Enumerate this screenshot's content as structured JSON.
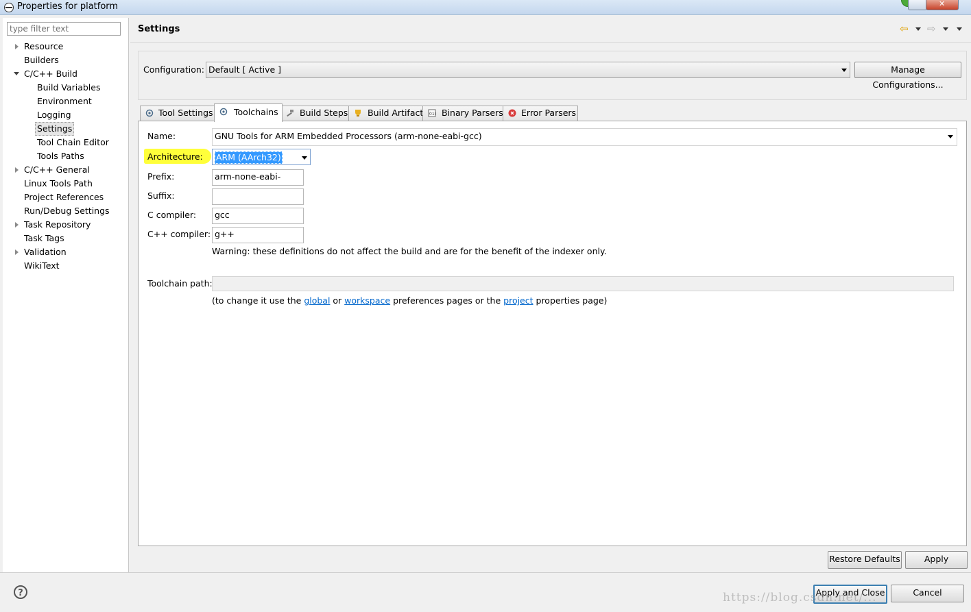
{
  "window": {
    "title": "Properties for platform"
  },
  "tree": {
    "filter_placeholder": "type filter text",
    "items": [
      {
        "label": "Resource"
      },
      {
        "label": "Builders"
      },
      {
        "label": "C/C++ Build"
      },
      {
        "label": "Build Variables"
      },
      {
        "label": "Environment"
      },
      {
        "label": "Logging"
      },
      {
        "label": "Settings"
      },
      {
        "label": "Tool Chain Editor"
      },
      {
        "label": "Tools Paths"
      },
      {
        "label": "C/C++ General"
      },
      {
        "label": "Linux Tools Path"
      },
      {
        "label": "Project References"
      },
      {
        "label": "Run/Debug Settings"
      },
      {
        "label": "Task Repository"
      },
      {
        "label": "Task Tags"
      },
      {
        "label": "Validation"
      },
      {
        "label": "WikiText"
      }
    ]
  },
  "page": {
    "title": "Settings",
    "configuration_label": "Configuration:",
    "configuration_value": "Default  [ Active ]",
    "manage_button": "Manage Configurations..."
  },
  "tabs": [
    {
      "label": "Tool Settings",
      "icon": "gear-icon"
    },
    {
      "label": "Toolchains",
      "icon": "gear-icon"
    },
    {
      "label": "Build Steps",
      "icon": "hammer-icon"
    },
    {
      "label": "Build Artifact",
      "icon": "trophy-icon"
    },
    {
      "label": "Binary Parsers",
      "icon": "binary-icon"
    },
    {
      "label": "Error Parsers",
      "icon": "error-icon"
    }
  ],
  "toolchains": {
    "name_label": "Name:",
    "name_value": "GNU Tools for ARM Embedded Processors (arm-none-eabi-gcc)",
    "architecture_label": "Architecture:",
    "architecture_value": "ARM (AArch32)",
    "prefix_label": "Prefix:",
    "prefix_value": "arm-none-eabi-",
    "suffix_label": "Suffix:",
    "suffix_value": "",
    "c_compiler_label": "C compiler:",
    "c_compiler_value": "gcc",
    "cpp_compiler_label": "C++ compiler:",
    "cpp_compiler_value": "g++",
    "warning": "Warning: these definitions do not affect the build and are for the benefit of the indexer only.",
    "toolchain_path_label": "Toolchain path:",
    "toolchain_path_value": "",
    "hint_prefix": "(to change it use the ",
    "hint_global": "global",
    "hint_or": " or ",
    "hint_workspace": "workspace",
    "hint_mid": " preferences pages or the ",
    "hint_project": "project",
    "hint_suffix": " properties page)"
  },
  "buttons": {
    "restore_defaults": "Restore Defaults",
    "apply": "Apply",
    "apply_and_close": "Apply and Close",
    "cancel": "Cancel"
  },
  "watermark": "https://blog.csdn.net/...",
  "colors": {
    "highlight": "#ffff3a",
    "selection": "#3399ff",
    "link": "#0066cc"
  }
}
